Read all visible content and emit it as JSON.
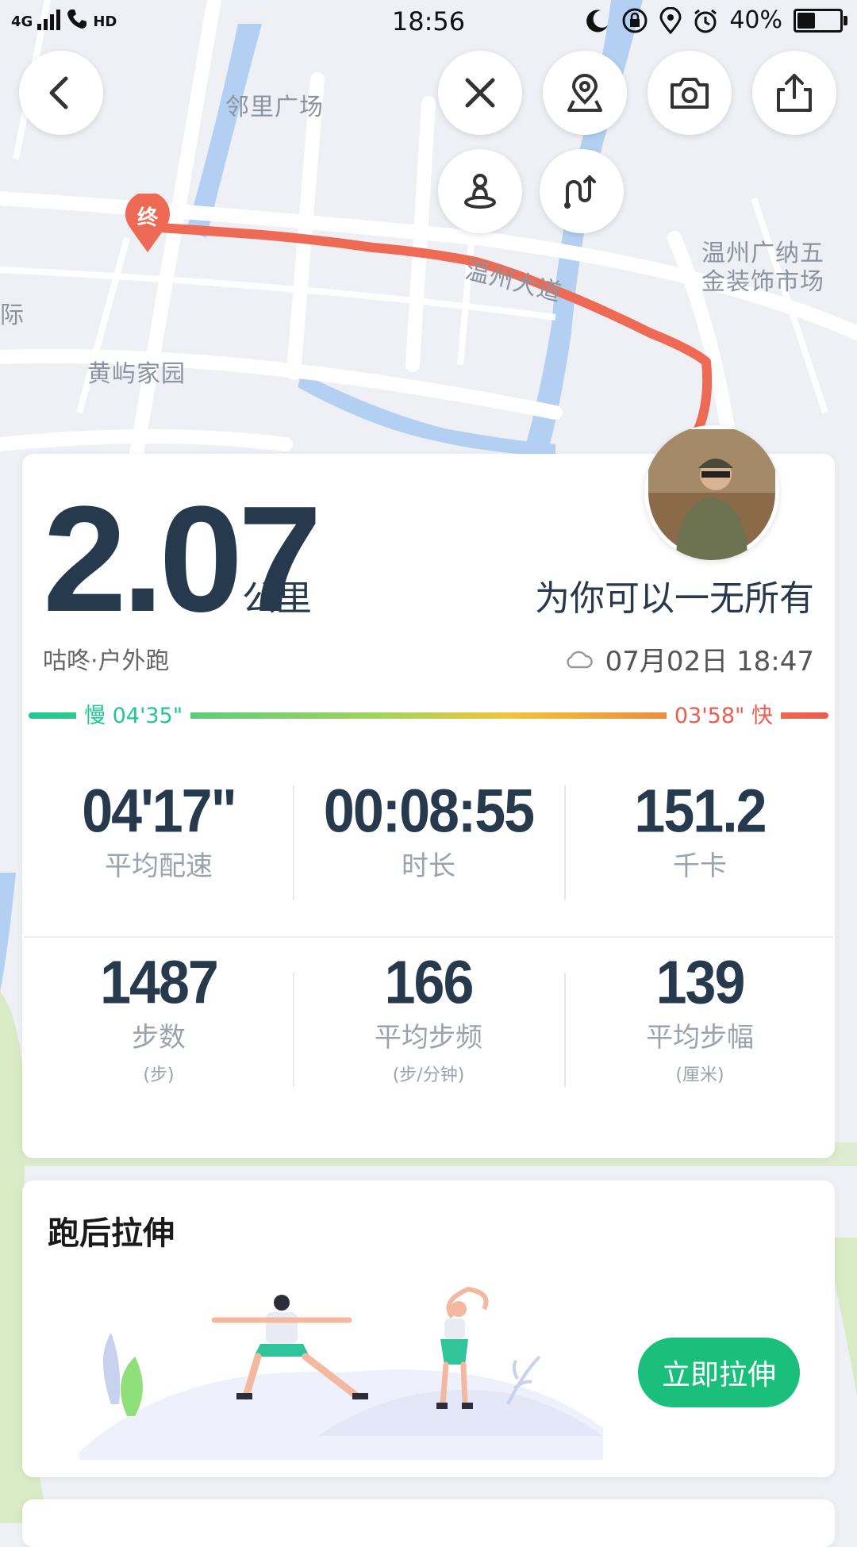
{
  "status_bar": {
    "network": "4G",
    "hd": "HD",
    "time": "18:56",
    "battery": "40%",
    "battery_level": 0.4
  },
  "map": {
    "labels": [
      "邻里广场",
      "温州广纳五",
      "金装饰市场",
      "温州大道",
      "黄屿家园",
      "际"
    ],
    "end_marker": "终",
    "route_color": "#ee6a55"
  },
  "toolbar": {
    "back_icon": "back-icon",
    "close_icon": "close-icon",
    "location_icon": "location-icon",
    "camera_icon": "camera-icon",
    "share_icon": "share-icon",
    "person_icon": "person-icon",
    "route_icon": "route-icon"
  },
  "summary": {
    "distance": "2.07",
    "unit": "公里",
    "motto": "为你可以一无所有",
    "sport_type": "咕咚·户外跑",
    "date": "07月02日 18:47",
    "pace_slow": "慢 04'35\"",
    "pace_fast": "03'58\" 快"
  },
  "stats": [
    {
      "value": "04'17\"",
      "label": "平均配速",
      "sub": ""
    },
    {
      "value": "00:08:55",
      "label": "时长",
      "sub": ""
    },
    {
      "value": "151.2",
      "label": "千卡",
      "sub": ""
    },
    {
      "value": "1487",
      "label": "步数",
      "sub": "(步)"
    },
    {
      "value": "166",
      "label": "平均步频",
      "sub": "(步/分钟)"
    },
    {
      "value": "139",
      "label": "平均步幅",
      "sub": "(厘米)"
    }
  ],
  "stretch": {
    "title": "跑后拉伸",
    "button": "立即拉伸"
  },
  "colors": {
    "accent_green": "#19bf7b",
    "slow": "#1fc795",
    "fast": "#ec5b4f",
    "text_dark": "#26394d"
  }
}
